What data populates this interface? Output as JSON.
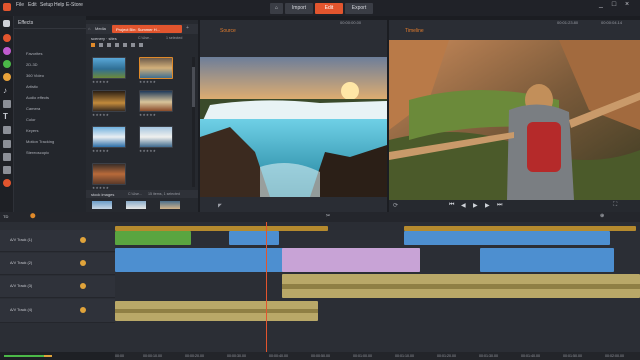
{
  "menu": [
    "File",
    "Edit",
    "Setup",
    "Help",
    "E-Store"
  ],
  "nav": {
    "import": "Import",
    "edit": "Edit",
    "export": "Export"
  },
  "window_controls": [
    "_",
    "□",
    "×"
  ],
  "effects": {
    "header": "Effects",
    "items": [
      "Favorites",
      "2D-3D",
      "360 Video",
      "Artistic",
      "Audio effects",
      "Camera",
      "Color",
      "Keyers",
      "Motion Tracking",
      "Stereoscopic"
    ]
  },
  "library": {
    "tabs": {
      "media": "Media",
      "project": "Project Bin: Summer H..."
    },
    "collection": "scenery · sites",
    "count": "C:\\Use...",
    "selected": "1 selected",
    "bottom_collection": "stock images",
    "bottom_count": "C:\\Use...",
    "bottom_selected": "15 items, 1 selected"
  },
  "source": {
    "title": "Source",
    "timecode": "00:00:00.00"
  },
  "timeline_monitor": {
    "title": "Timeline",
    "timecode": "00:01:23.80",
    "duration": "00:00:04.14"
  },
  "timeline": {
    "label": "TD",
    "tracks": [
      "A/V Track (1)",
      "A/V Track (2)",
      "A/V Track (3)",
      "A/V Track (4)"
    ],
    "ruler": [
      "00:00",
      "00:00:10.00",
      "00:00:20.00",
      "00:00:30.00",
      "00:00:40.00",
      "00:00:50.00",
      "00:01:00.00",
      "00:01:10.00",
      "00:01:20.00",
      "00:01:30.00",
      "00:01:40.00",
      "00:01:50.00",
      "00:02:00.00"
    ]
  },
  "colors": {
    "accent": "#e2552e",
    "orange": "#e08a2a",
    "blue_clip": "#4d8fd0",
    "purple_clip": "#c8a3d6",
    "green_clip": "#5aa540",
    "audio_clip": "#b9a868"
  }
}
